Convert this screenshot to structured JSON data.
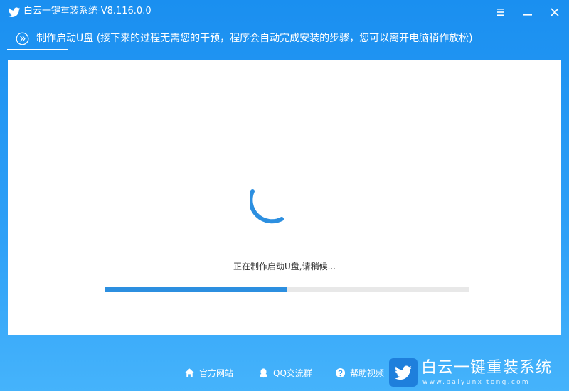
{
  "window": {
    "title": "白云一键重装系统-V8.116.0.0",
    "controls": [
      {
        "name": "menu-button",
        "icon": "hamburger-menu-icon"
      },
      {
        "name": "minimize-button",
        "icon": "minimize-icon"
      },
      {
        "name": "close-button",
        "icon": "close-icon"
      }
    ]
  },
  "step": {
    "icon": "double-chevron-right-icon",
    "title": "制作启动U盘 (接下来的过程无需您的干预，程序会自动完成安装的步骤，您可以离开电脑稍作放松)"
  },
  "main": {
    "status_text": "正在制作启动U盘,请稍候...",
    "progress_fraction": 0.5
  },
  "footer": {
    "links": [
      {
        "label": "官方网站",
        "icon": "home-icon"
      },
      {
        "label": "QQ交流群",
        "icon": "qq-penguin-icon"
      },
      {
        "label": "帮助视频",
        "icon": "help-icon"
      }
    ]
  },
  "brand": {
    "name": "白云一键重装系统",
    "url": "www.baiyunxitong.com",
    "logo_icon": "bird-icon"
  },
  "colors": {
    "accent": "#2c8fe0",
    "background_top": "#1a8ff0",
    "background_bottom": "#45b3fb",
    "panel": "#ffffff",
    "progress_track": "#e8e8e8"
  }
}
